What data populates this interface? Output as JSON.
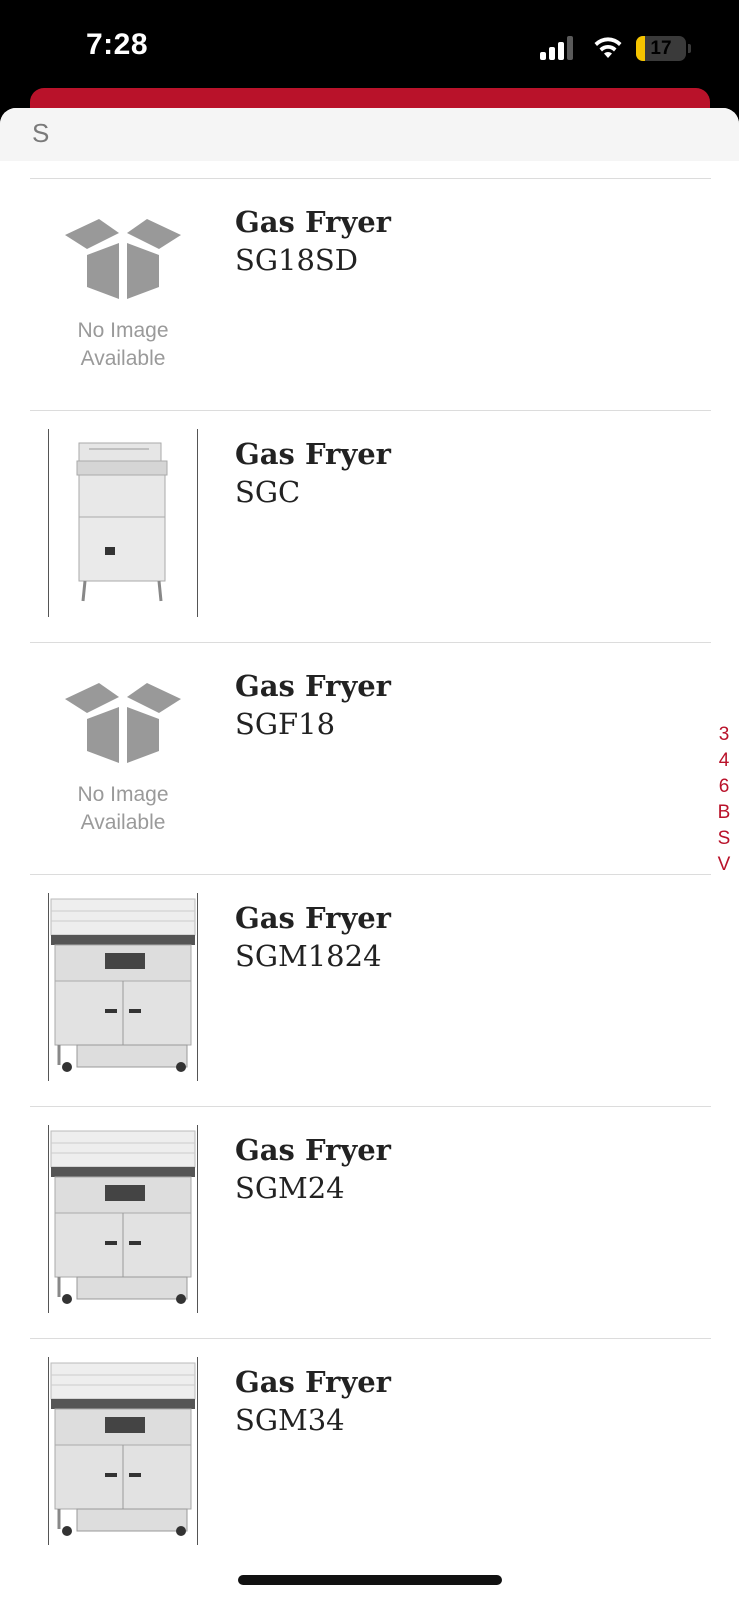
{
  "status_bar": {
    "time": "7:28",
    "battery_level": "17",
    "battery_fraction": 0.17,
    "icons": [
      "signal-icon",
      "wifi-icon",
      "battery-icon"
    ]
  },
  "colors": {
    "accent": "#b9122a",
    "header_bg": "#f5f5f5"
  },
  "section": {
    "letter": "S"
  },
  "no_image_text": {
    "line1": "No Image",
    "line2": "Available"
  },
  "items": [
    {
      "title": "Gas Fryer",
      "model": "SG18SD",
      "image": "no-image"
    },
    {
      "title": "Gas Fryer",
      "model": "SGC",
      "image": "fryer-photo"
    },
    {
      "title": "Gas Fryer",
      "model": "SGF18",
      "image": "no-image"
    },
    {
      "title": "Gas Fryer",
      "model": "SGM1824",
      "image": "fryer-photo"
    },
    {
      "title": "Gas Fryer",
      "model": "SGM24",
      "image": "fryer-photo"
    },
    {
      "title": "Gas Fryer",
      "model": "SGM34",
      "image": "fryer-photo"
    }
  ],
  "index_bar": [
    "3",
    "4",
    "6",
    "B",
    "S",
    "V"
  ]
}
